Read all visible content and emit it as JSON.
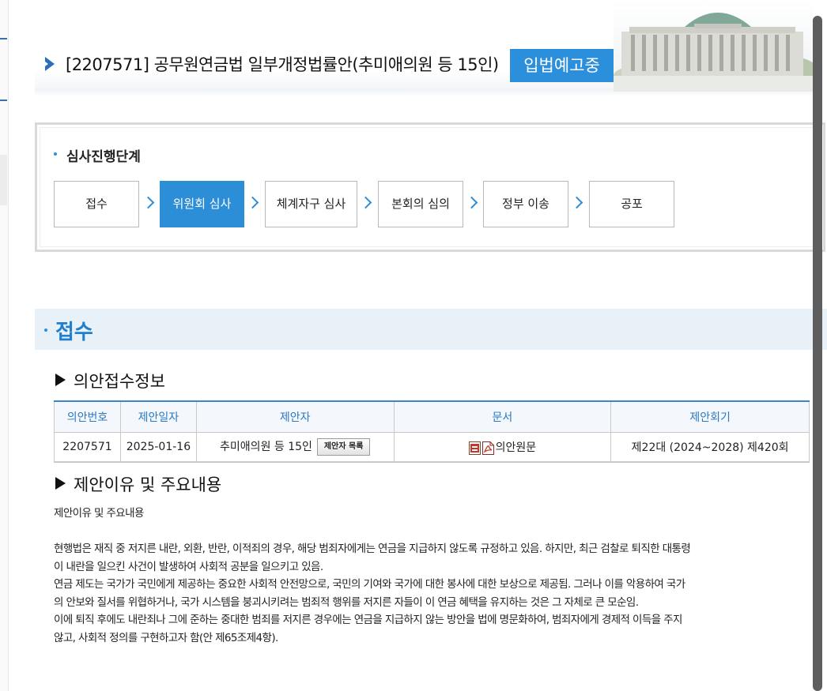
{
  "bill": {
    "title": "[2207571] 공무원연금법 일부개정법률안(추미애의원 등 15인)",
    "status": "입법예고중"
  },
  "progress": {
    "label": "심사진행단계",
    "steps": [
      "접수",
      "위원회 심사",
      "체계자구 심사",
      "본회의 심의",
      "정부 이송",
      "공포"
    ],
    "active_step": "위원회 심사"
  },
  "section": {
    "title": "접수"
  },
  "receipt_info": {
    "heading": "의안접수정보",
    "columns": [
      "의안번호",
      "제안일자",
      "제안자",
      "문서",
      "제안회기"
    ],
    "row": {
      "bill_no": "2207571",
      "date": "2025-01-16",
      "proposer": "추미애의원 등 15인",
      "proposer_button": "제안자 목록",
      "document": "의안원문",
      "session": "제22대 (2024~2028) 제420회"
    }
  },
  "reason": {
    "heading": "제안이유 및 주요내용",
    "label": "제안이유 및 주요내용",
    "lines": [
      "현행법은 재직 중 저지른 내란, 외환, 반란, 이적죄의 경우, 해당 범죄자에게는 연금을 지급하지 않도록 규정하고 있음. 하지만, 최근 검찰로 퇴직한 대통령",
      "이 내란을 일으킨 사건이 발생하여 사회적 공분을 일으키고 있음.",
      "연금 제도는 국가가 국민에게 제공하는 중요한 사회적 안전망으로, 국민의 기여와 국가에 대한 봉사에 대한 보상으로 제공됨. 그러나 이를 악용하여 국가",
      "의 안보와 질서를 위협하거나, 국가 시스템을 붕괴시키려는 범죄적 행위를 저지른 자들이 이 연금 혜택을 유지하는 것은 그 자체로 큰 모순임.",
      "이에 퇴직 후에도 내란죄나 그에 준하는 중대한 범죄를 저지른 경우에는 연금을 지급하지 않는 방안을 법에 명문화하여, 범죄자에게 경제적 이득을 주지",
      "않고, 사회적 정의를 구현하고자 함(안 제65조제4항)."
    ]
  },
  "colors": {
    "accent": "#2b8fdc",
    "band": "#e8f0f8",
    "active_step": "#2c8ed6"
  }
}
